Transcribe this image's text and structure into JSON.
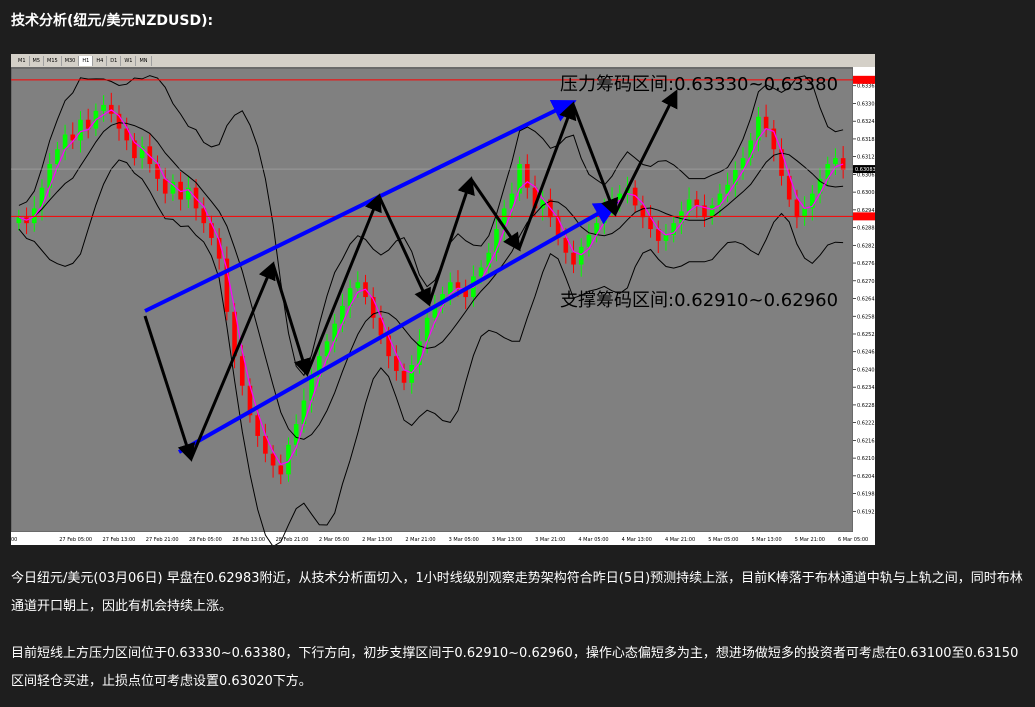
{
  "page": {
    "title": "技术分析(纽元/美元NZDUSD):",
    "paragraph1": "今日纽元/美元(03月06日) 早盘在0.62983附近，从技术分析面切入，1小时线级别观察走势架构符合昨日(5日)预测持续上涨，目前K棒落于布林通道中轨与上轨之间，同时布林通道开口朝上，因此有机会持续上涨。",
    "paragraph2": "目前短线上方压力区间位于0.63330~0.63380，下行方向，初步支撑区间于0.62910~0.62960，操作心态偏短多为主，想进场做短多的投资者可考虑在0.63100至0.63150区间轻仓买进，止损点位可考虑设置0.63020下方。"
  },
  "toolbar": {
    "timeframes": [
      "M1",
      "M5",
      "M15",
      "M30",
      "H1",
      "H4",
      "D1",
      "W1",
      "MN"
    ],
    "active": "H1"
  },
  "colors": {
    "chart_bg": "#808080",
    "bull_candle": "#00ff00",
    "bear_candle": "#ff0000",
    "bollinger": "#000000",
    "ma": "#ff00ff",
    "resistance_line": "#ff0000",
    "channel": "#0000ff",
    "zigzag": "#000000",
    "page_bg": "#1e1e1e"
  },
  "chart_data": {
    "type": "candlestick",
    "symbol": "NZDUSD",
    "timeframe": "H1",
    "ylim": [
      0.61855,
      0.63425
    ],
    "y_ticks": [
      "0.63365",
      "0.63305",
      "0.63245",
      "0.63185",
      "0.63125",
      "0.63065",
      "0.63005",
      "0.62945",
      "0.62885",
      "0.62825",
      "0.62765",
      "0.62705",
      "0.62645",
      "0.62585",
      "0.62525",
      "0.62465",
      "0.62405",
      "0.62345",
      "0.62285",
      "0.62225",
      "0.62165",
      "0.62105",
      "0.62045",
      "0.61985",
      "0.61925"
    ],
    "x_ticks": [
      "00",
      "27 Feb 05:00",
      "27 Feb 13:00",
      "27 Feb 21:00",
      "28 Feb 05:00",
      "28 Feb 13:00",
      "28 Feb 21:00",
      "2 Mar 05:00",
      "2 Mar 13:00",
      "2 Mar 21:00",
      "3 Mar 05:00",
      "3 Mar 13:00",
      "3 Mar 21:00",
      "4 Mar 05:00",
      "4 Mar 13:00",
      "4 Mar 21:00",
      "5 Mar 05:00",
      "5 Mar 13:00",
      "5 Mar 21:00",
      "6 Mar 05:00"
    ],
    "current_price": "0.63083",
    "current_price_value": 0.63083,
    "support_marker_value": 0.62923,
    "resistance_level": 0.6338,
    "support_level": 0.6291,
    "resistance_label": "压力筹码区间:0.63330~0.63380",
    "support_label": "支撑筹码区间:0.62910~0.62960",
    "closes": [
      0.6292,
      0.629,
      0.6295,
      0.6302,
      0.631,
      0.6315,
      0.632,
      0.6318,
      0.6325,
      0.6322,
      0.6328,
      0.633,
      0.6327,
      0.6322,
      0.6318,
      0.6312,
      0.6316,
      0.631,
      0.6305,
      0.63,
      0.6304,
      0.6298,
      0.6302,
      0.6295,
      0.629,
      0.6285,
      0.6278,
      0.626,
      0.6245,
      0.6235,
      0.6225,
      0.6218,
      0.6212,
      0.6208,
      0.6205,
      0.6215,
      0.6222,
      0.623,
      0.6238,
      0.6245,
      0.625,
      0.6256,
      0.6262,
      0.6268,
      0.627,
      0.6265,
      0.6258,
      0.6252,
      0.6245,
      0.624,
      0.6236,
      0.6242,
      0.625,
      0.6258,
      0.6262,
      0.6266,
      0.627,
      0.6268,
      0.6265,
      0.6272,
      0.6275,
      0.628,
      0.6288,
      0.6295,
      0.63,
      0.631,
      0.6302,
      0.6295,
      0.6298,
      0.6292,
      0.6285,
      0.628,
      0.6276,
      0.6282,
      0.6286,
      0.629,
      0.6295,
      0.6298,
      0.63,
      0.6302,
      0.6296,
      0.6292,
      0.6288,
      0.6284,
      0.6286,
      0.629,
      0.6294,
      0.6298,
      0.6296,
      0.6292,
      0.6296,
      0.63,
      0.6303,
      0.6308,
      0.6312,
      0.6318,
      0.6326,
      0.6322,
      0.6315,
      0.6306,
      0.6298,
      0.6292,
      0.6295,
      0.63,
      0.6305,
      0.631,
      0.6312,
      0.6308
    ]
  }
}
